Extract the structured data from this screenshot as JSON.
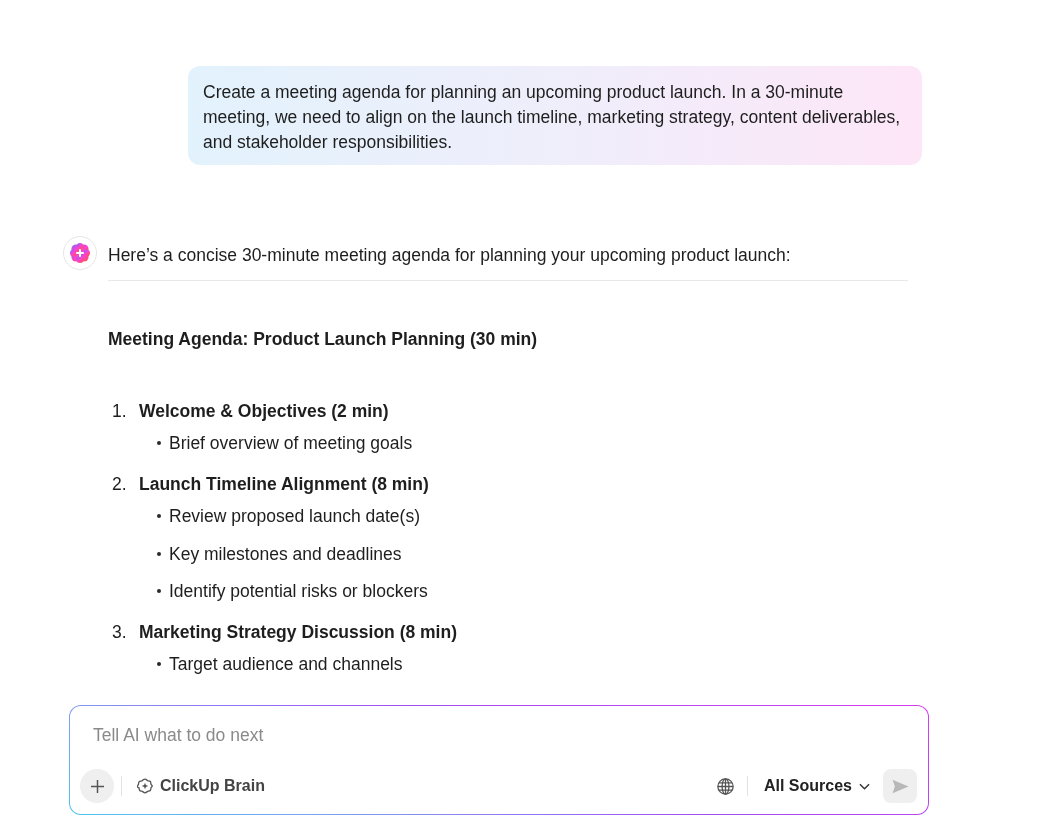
{
  "user_message": {
    "text": "Create a meeting agenda for planning an upcoming product launch. In a 30-minute meeting, we need to align on the launch timeline, marketing strategy, content deliverables, and stakeholder responsibilities."
  },
  "assistant": {
    "intro": "Here’s a concise 30-minute meeting agenda for planning your upcoming product launch:",
    "heading": "Meeting Agenda: Product Launch Planning (30 min)",
    "sections": [
      {
        "number": "1.",
        "title": "Welcome & Objectives (2 min)",
        "bullets": [
          "Brief overview of meeting goals"
        ]
      },
      {
        "number": "2.",
        "title": "Launch Timeline Alignment (8 min)",
        "bullets": [
          "Review proposed launch date(s)",
          "Key milestones and deadlines",
          "Identify potential risks or blockers"
        ]
      },
      {
        "number": "3.",
        "title": "Marketing Strategy Discussion (8 min)",
        "bullets": [
          "Target audience and channels"
        ]
      }
    ]
  },
  "composer": {
    "placeholder": "Tell AI what to do next",
    "assistant_name": "ClickUp Brain",
    "sources": "All Sources"
  }
}
